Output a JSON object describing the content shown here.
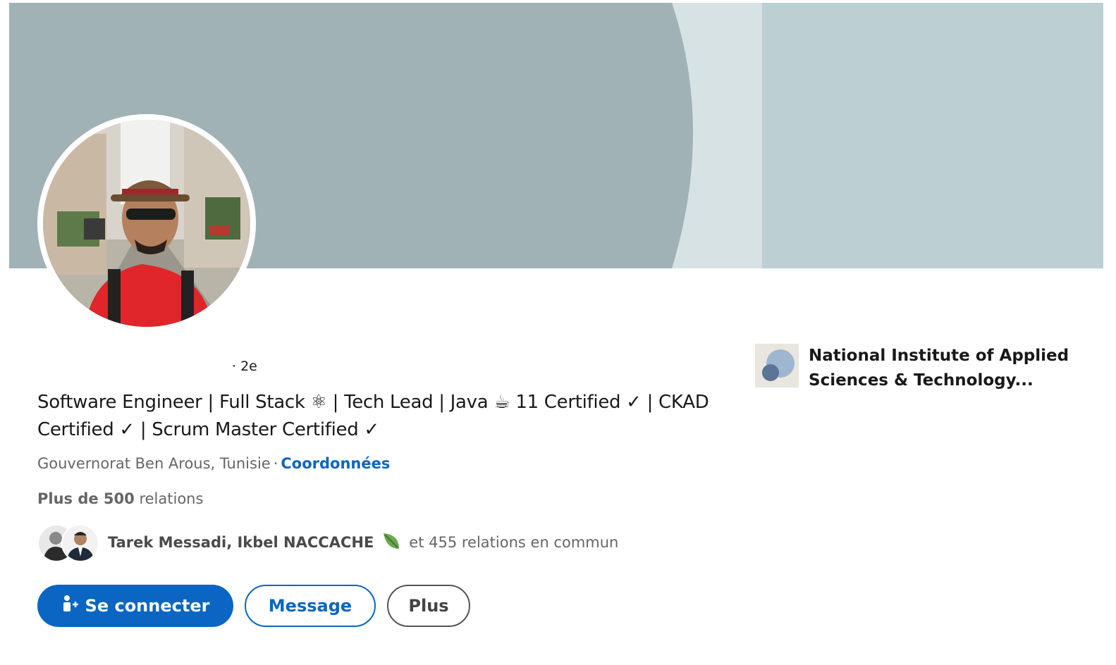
{
  "profile": {
    "degree": "· 2e",
    "headline": "Software Engineer | Full Stack ⚛ | Tech Lead | Java ☕ 11 Certified ✓ | CKAD Certified ✓ | Scrum Master Certified ✓",
    "location": "Gouvernorat Ben Arous, Tunisie",
    "contact_info_label": "Coordonnées",
    "connections_count": "Plus de 500",
    "connections_suffix": "relations",
    "mutual_names": "Tarek Messadi, Ikbel NACCACHE",
    "mutual_suffix": "et 455 relations en commun",
    "education": "National Institute of Applied Sciences & Technology..."
  },
  "actions": {
    "connect_label": "Se connecter",
    "message_label": "Message",
    "more_label": "Plus"
  },
  "colors": {
    "primary": "#0a66c2",
    "banner_dark": "#a0b2b5",
    "banner_light": "#bccfd3",
    "banner_mid": "#d6e2e4"
  },
  "icons": {
    "connect": "person-add-icon",
    "leaf": "leaf-icon",
    "school_logo": "school-logo"
  }
}
